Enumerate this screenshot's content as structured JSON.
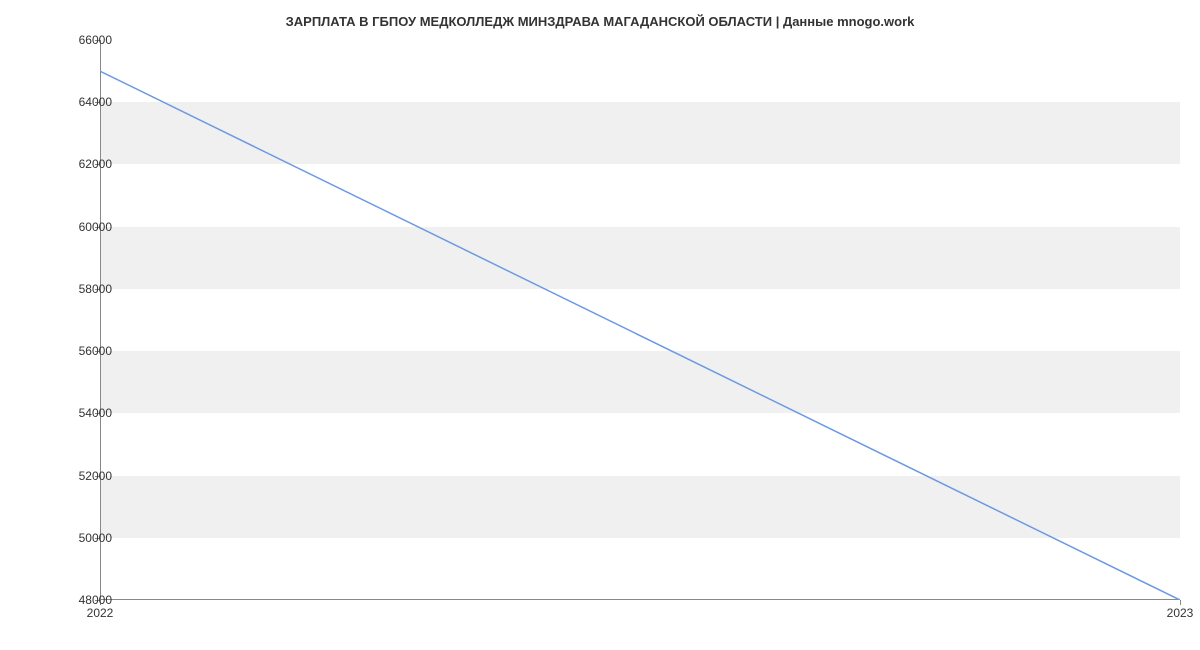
{
  "chart_data": {
    "type": "line",
    "title": "ЗАРПЛАТА В ГБПОУ  МЕДКОЛЛЕДЖ МИНЗДРАВА МАГАДАНСКОЙ ОБЛАСТИ | Данные mnogo.work",
    "x": [
      2022,
      2023
    ],
    "values": [
      65000,
      48000
    ],
    "xlabel": "",
    "ylabel": "",
    "xlim": [
      2022,
      2023
    ],
    "ylim": [
      48000,
      66000
    ],
    "x_ticks": [
      "2022",
      "2023"
    ],
    "y_ticks": [
      "48000",
      "50000",
      "52000",
      "54000",
      "56000",
      "58000",
      "60000",
      "62000",
      "64000",
      "66000"
    ],
    "line_color": "#6b99e3",
    "band_color": "#f0f0f0"
  }
}
